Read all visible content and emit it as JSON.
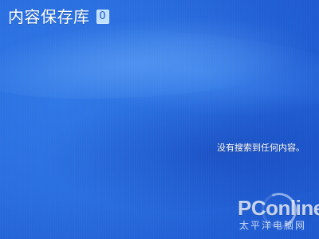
{
  "screen": {
    "title": "内容保存库",
    "badge": "0",
    "empty_message": "没有搜索到任何内容。"
  },
  "watermark": {
    "logo_text": "PConline",
    "subtitle": "太平洋电脑网"
  },
  "colors": {
    "background_base": "#2a6fe0",
    "text": "#ffffff",
    "badge_bg": "#bfe0ff",
    "badge_text": "#1d56c7"
  }
}
